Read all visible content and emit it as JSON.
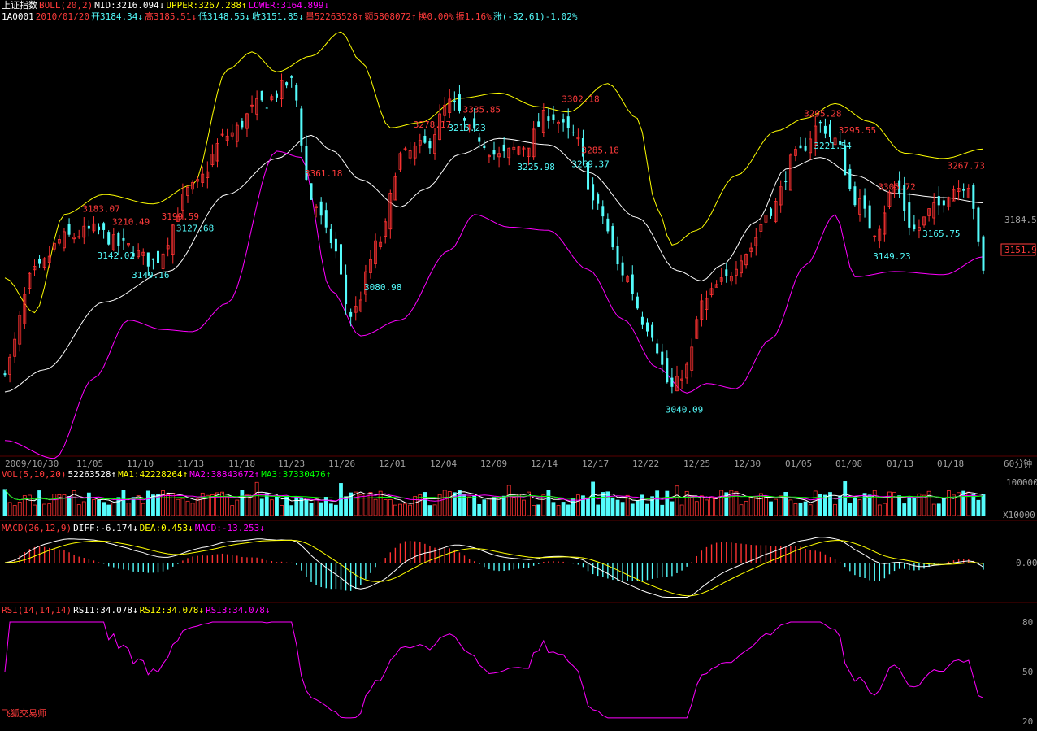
{
  "colors": {
    "up": "#ff3232",
    "down": "#54fcfc",
    "mid": "#ffffff",
    "upper": "#ffff00",
    "lower": "#ff00ff",
    "text_red": "#ff3b3b",
    "axis": "#a0a0a0",
    "vol_ma1": "#ffffff",
    "vol_ma2": "#ff00ff",
    "vol_ma3": "#00ff00"
  },
  "header": {
    "line1": [
      {
        "text": "上证指数",
        "color": "#ffffff"
      },
      {
        "text": "BOLL(20,2)",
        "color": "#ff3b3b"
      },
      {
        "text": "MID:3216.094↓",
        "color": "#ffffff"
      },
      {
        "text": "UPPER:3267.288↑",
        "color": "#ffff00"
      },
      {
        "text": "LOWER:3164.899↓",
        "color": "#ff00ff"
      }
    ],
    "line2": [
      {
        "text": "1A0001",
        "color": "#ffffff"
      },
      {
        "text": "2010/01/20",
        "color": "#ff3b3b"
      },
      {
        "text": "开3184.34↓",
        "color": "#54fcfc"
      },
      {
        "text": "高3185.51↓",
        "color": "#ff3b3b"
      },
      {
        "text": "低3148.55↓",
        "color": "#54fcfc"
      },
      {
        "text": "收3151.85↓",
        "color": "#54fcfc"
      },
      {
        "text": "量52263528↑",
        "color": "#ff3b3b"
      },
      {
        "text": "额5808072↑",
        "color": "#ff3b3b"
      },
      {
        "text": "换0.00%",
        "color": "#ff3b3b"
      },
      {
        "text": "振1.16%",
        "color": "#ff3b3b"
      },
      {
        "text": "涨(-32.61)-1.02%",
        "color": "#54fcfc"
      }
    ]
  },
  "vol_header": [
    {
      "text": "VOL(5,10,20)",
      "color": "#ff3b3b"
    },
    {
      "text": "52263528↑",
      "color": "#ffffff"
    },
    {
      "text": "MA1:42228264↑",
      "color": "#ffff00"
    },
    {
      "text": "MA2:38843672↑",
      "color": "#ff00ff"
    },
    {
      "text": "MA3:37330476↑",
      "color": "#00ff00"
    }
  ],
  "macd_header": [
    {
      "text": "MACD(26,12,9)",
      "color": "#ff3b3b"
    },
    {
      "text": "DIFF:-6.174↓",
      "color": "#ffffff"
    },
    {
      "text": "DEA:0.453↓",
      "color": "#ffff00"
    },
    {
      "text": "MACD:-13.253↓",
      "color": "#ff00ff"
    }
  ],
  "rsi_header": [
    {
      "text": "RSI(14,14,14)",
      "color": "#ff3b3b"
    },
    {
      "text": "RSI1:34.078↓",
      "color": "#ffffff"
    },
    {
      "text": "RSI2:34.078↓",
      "color": "#ffff00"
    },
    {
      "text": "RSI3:34.078↓",
      "color": "#ff00ff"
    }
  ],
  "footer": "飞狐交易师",
  "chart_data": {
    "type": "candlestick",
    "title": "上证指数",
    "period": "60分钟",
    "x_labels": [
      "2009/10/30",
      "11/05",
      "11/10",
      "11/13",
      "11/18",
      "11/23",
      "11/26",
      "12/01",
      "12/04",
      "12/09",
      "12/14",
      "12/17",
      "12/22",
      "12/25",
      "12/30",
      "01/05",
      "01/08",
      "01/13",
      "01/18"
    ],
    "price_axis": {
      "ticks": [
        "3184.5"
      ],
      "current": "3151.9",
      "ylim": [
        2980,
        3385
      ]
    },
    "annotations": [
      {
        "text": "3361.18",
        "type": "high"
      },
      {
        "text": "3335.85",
        "type": "high"
      },
      {
        "text": "3302.18",
        "type": "high"
      },
      {
        "text": "3285.18",
        "type": "high"
      },
      {
        "text": "3278.17",
        "type": "high"
      },
      {
        "text": "3210.49",
        "type": "high"
      },
      {
        "text": "3199.59",
        "type": "high"
      },
      {
        "text": "3183.07",
        "type": "high"
      },
      {
        "text": "3295.28",
        "type": "high"
      },
      {
        "text": "3295.55",
        "type": "high"
      },
      {
        "text": "3305.72",
        "type": "high"
      },
      {
        "text": "3267.73",
        "type": "high"
      },
      {
        "text": "3142.02",
        "type": "low"
      },
      {
        "text": "3149.16",
        "type": "low"
      },
      {
        "text": "3127.68",
        "type": "low"
      },
      {
        "text": "3080.98",
        "type": "low"
      },
      {
        "text": "3215.23",
        "type": "low"
      },
      {
        "text": "3225.98",
        "type": "low"
      },
      {
        "text": "3269.37",
        "type": "low"
      },
      {
        "text": "3040.09",
        "type": "low"
      },
      {
        "text": "3221.54",
        "type": "low"
      },
      {
        "text": "3149.23",
        "type": "low"
      },
      {
        "text": "3165.75",
        "type": "low"
      }
    ],
    "boll_mid_anchors": [
      [
        0,
        3037
      ],
      [
        8,
        3058
      ],
      [
        20,
        3122
      ],
      [
        33,
        3151
      ],
      [
        45,
        3224
      ],
      [
        55,
        3258
      ],
      [
        62,
        3280
      ],
      [
        66,
        3266
      ],
      [
        72,
        3238
      ],
      [
        80,
        3212
      ],
      [
        85,
        3229
      ],
      [
        92,
        3262
      ],
      [
        100,
        3277
      ],
      [
        110,
        3271
      ],
      [
        118,
        3245
      ],
      [
        128,
        3202
      ],
      [
        136,
        3152
      ],
      [
        141,
        3142
      ],
      [
        145,
        3157
      ],
      [
        152,
        3198
      ],
      [
        158,
        3248
      ],
      [
        165,
        3259
      ],
      [
        172,
        3242
      ],
      [
        180,
        3225
      ],
      [
        190,
        3221
      ],
      [
        198,
        3216
      ]
    ],
    "boll_upper_anchors": [
      [
        0,
        3145
      ],
      [
        6,
        3112
      ],
      [
        12,
        3205
      ],
      [
        20,
        3224
      ],
      [
        30,
        3215
      ],
      [
        38,
        3233
      ],
      [
        45,
        3342
      ],
      [
        50,
        3359
      ],
      [
        55,
        3340
      ],
      [
        62,
        3355
      ],
      [
        68,
        3378
      ],
      [
        72,
        3350
      ],
      [
        78,
        3287
      ],
      [
        84,
        3292
      ],
      [
        92,
        3315
      ],
      [
        100,
        3320
      ],
      [
        108,
        3307
      ],
      [
        114,
        3302
      ],
      [
        122,
        3329
      ],
      [
        128,
        3296
      ],
      [
        132,
        3211
      ],
      [
        135,
        3176
      ],
      [
        140,
        3190
      ],
      [
        148,
        3242
      ],
      [
        156,
        3284
      ],
      [
        162,
        3296
      ],
      [
        168,
        3310
      ],
      [
        175,
        3293
      ],
      [
        182,
        3263
      ],
      [
        190,
        3258
      ],
      [
        198,
        3267
      ]
    ],
    "boll_lower_anchors": [
      [
        0,
        2991
      ],
      [
        10,
        2974
      ],
      [
        18,
        3050
      ],
      [
        25,
        3105
      ],
      [
        32,
        3096
      ],
      [
        38,
        3094
      ],
      [
        45,
        3121
      ],
      [
        55,
        3265
      ],
      [
        60,
        3259
      ],
      [
        66,
        3133
      ],
      [
        72,
        3090
      ],
      [
        80,
        3105
      ],
      [
        90,
        3171
      ],
      [
        95,
        3205
      ],
      [
        102,
        3193
      ],
      [
        110,
        3190
      ],
      [
        118,
        3153
      ],
      [
        125,
        3106
      ],
      [
        132,
        3060
      ],
      [
        138,
        3036
      ],
      [
        142,
        3045
      ],
      [
        148,
        3040
      ],
      [
        155,
        3087
      ],
      [
        162,
        3157
      ],
      [
        168,
        3205
      ],
      [
        172,
        3146
      ],
      [
        180,
        3151
      ],
      [
        190,
        3148
      ],
      [
        198,
        3165
      ]
    ],
    "close_anchors": [
      [
        0,
        3060
      ],
      [
        6,
        3150
      ],
      [
        12,
        3183
      ],
      [
        18,
        3190
      ],
      [
        24,
        3175
      ],
      [
        30,
        3160
      ],
      [
        38,
        3230
      ],
      [
        45,
        3280
      ],
      [
        52,
        3310
      ],
      [
        58,
        3330
      ],
      [
        62,
        3220
      ],
      [
        66,
        3180
      ],
      [
        70,
        3110
      ],
      [
        76,
        3180
      ],
      [
        80,
        3260
      ],
      [
        85,
        3270
      ],
      [
        90,
        3310
      ],
      [
        95,
        3280
      ],
      [
        100,
        3260
      ],
      [
        105,
        3270
      ],
      [
        110,
        3300
      ],
      [
        115,
        3280
      ],
      [
        120,
        3210
      ],
      [
        125,
        3150
      ],
      [
        130,
        3100
      ],
      [
        135,
        3040
      ],
      [
        138,
        3060
      ],
      [
        141,
        3120
      ],
      [
        145,
        3140
      ],
      [
        150,
        3170
      ],
      [
        155,
        3210
      ],
      [
        160,
        3260
      ],
      [
        165,
        3290
      ],
      [
        168,
        3275
      ],
      [
        172,
        3220
      ],
      [
        176,
        3190
      ],
      [
        180,
        3230
      ],
      [
        184,
        3190
      ],
      [
        188,
        3210
      ],
      [
        192,
        3230
      ],
      [
        195,
        3235
      ],
      [
        198,
        3151.85
      ]
    ],
    "high_labels_x": [
      [
        "3361.18",
        62
      ],
      [
        "3335.85",
        94
      ],
      [
        "3302.18",
        114
      ],
      [
        "3285.18",
        118
      ],
      [
        "3278.17",
        84
      ],
      [
        "3210.49",
        23
      ],
      [
        "3199.59",
        33
      ],
      [
        "3183.07",
        17
      ],
      [
        "3295.28",
        163
      ],
      [
        "3295.55",
        170
      ],
      [
        "3305.72",
        178
      ],
      [
        "3267.73",
        192
      ]
    ],
    "low_labels_x": [
      [
        "3142.02",
        20
      ],
      [
        "3149.16",
        27
      ],
      [
        "3127.68",
        36
      ],
      [
        "3080.98",
        74
      ],
      [
        "3215.23",
        91
      ],
      [
        "3225.98",
        105
      ],
      [
        "3269.37",
        116
      ],
      [
        "3040.09",
        135
      ],
      [
        "3221.54",
        165
      ],
      [
        "3149.23",
        177
      ],
      [
        "3165.75",
        187
      ]
    ],
    "volume": {
      "unit": "X10000",
      "axis_tick": "100000",
      "last": 52263528
    },
    "macd": {
      "diff": -6.174,
      "dea": 0.453,
      "macd": -13.253,
      "axis_tick": "0.00"
    },
    "rsi": {
      "rsi1": 34.078,
      "axis_ticks": [
        "80",
        "50",
        "20"
      ]
    }
  }
}
